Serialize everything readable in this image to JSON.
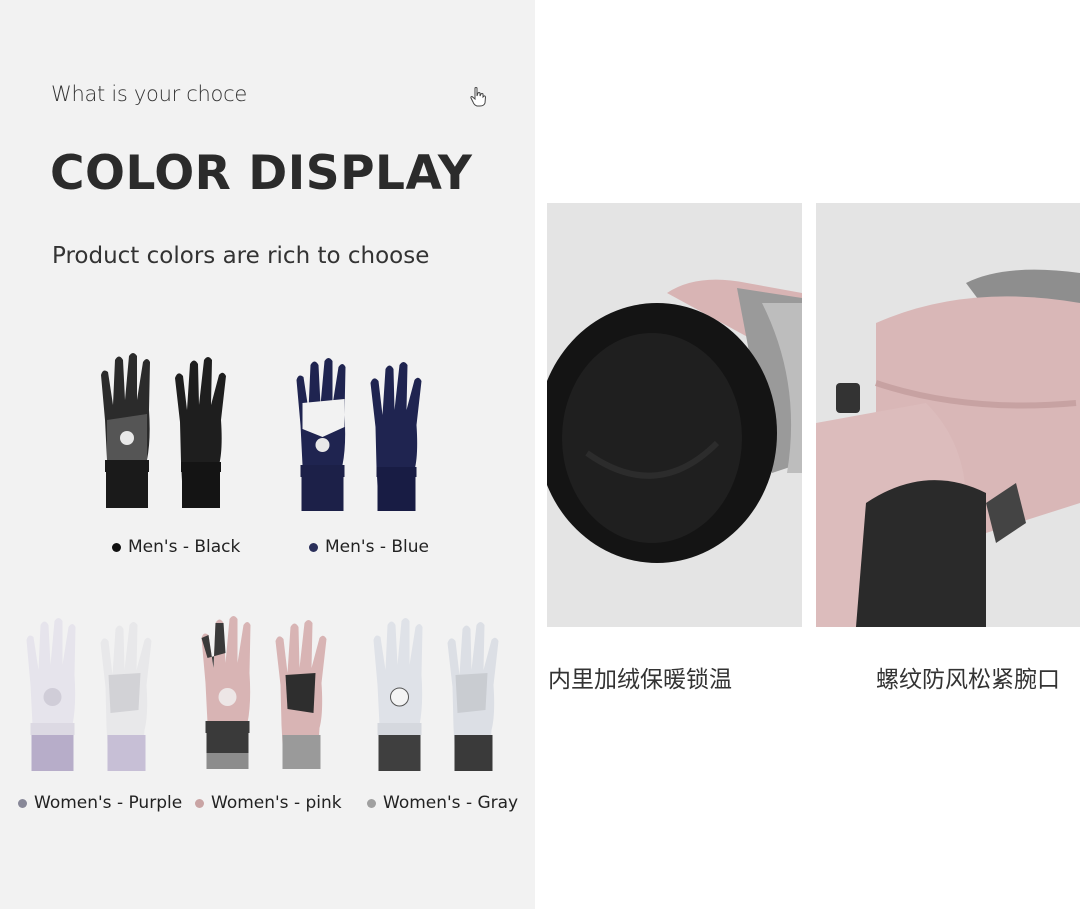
{
  "header": {
    "subtitle": "What is your choce",
    "title": "COLOR DISPLAY",
    "tagline": "Product colors are rich to choose"
  },
  "products": [
    {
      "label": "Men's - Black",
      "dot_color": "#111111",
      "main": "#2b2b2b",
      "accent": "#555555",
      "cuff": "#1a1a1a"
    },
    {
      "label": "Men's - Blue",
      "dot_color": "#2a2f5a",
      "main": "#1f2450",
      "accent": "#f2f2f2",
      "cuff": "#1c2048"
    },
    {
      "label": "Women's - Purple",
      "dot_color": "#888898",
      "main": "#e6e4ec",
      "accent": "#d2d2d6",
      "cuff": "#b7adc9"
    },
    {
      "label": "Women's - pink",
      "dot_color": "#c9a4a4",
      "main": "#d8b4b4",
      "accent": "#3a3a3a",
      "cuff": "#8c8c8c"
    },
    {
      "label": "Women's - Gray",
      "dot_color": "#a0a0a0",
      "main": "#dfe2e8",
      "accent": "#c9ccd1",
      "cuff": "#3f3f3f"
    }
  ],
  "details": [
    {
      "caption": "内里加绒保暖锁温"
    },
    {
      "caption": "螺纹防风松紧腕口"
    }
  ]
}
